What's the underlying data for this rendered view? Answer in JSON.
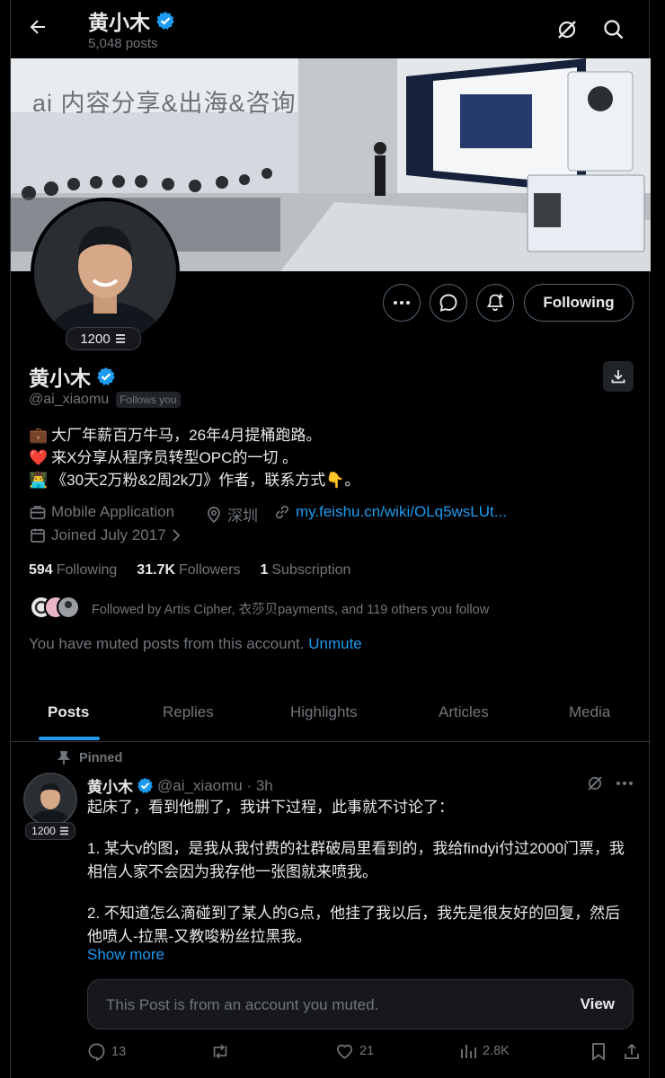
{
  "header": {
    "title": "黄小木",
    "posts_count": "5,048 posts"
  },
  "banner": {
    "overlay_text": "ai 内容分享&出海&咨询"
  },
  "profile": {
    "avatar_badge": "1200",
    "name": "黄小木",
    "handle": "@ai_xiaomu",
    "follows_you": "Follows you",
    "follow_button": "Following",
    "bio": [
      {
        "emoji": "💼",
        "text": "大厂年薪百万牛马，26年4月提桶跑路。"
      },
      {
        "emoji": "❤️",
        "text": "来X分享从程序员转型OPC的一切 。"
      },
      {
        "emoji": "👨‍💻",
        "text": "《30天2万粉&2周2k刀》作者，联系方式👇。"
      }
    ],
    "category": "Mobile Application",
    "location": "深圳",
    "website": "my.feishu.cn/wiki/OLq5wsLUt...",
    "joined": "Joined July 2017",
    "stats": {
      "following_count": "594",
      "following_label": "Following",
      "followers_count": "31.7K",
      "followers_label": "Followers",
      "subscription_count": "1",
      "subscription_label": "Subscription"
    },
    "followed_by": "Followed by Artis Cipher, 衣莎贝payments, and 119 others you follow",
    "muted_note": "You have muted posts from this account.",
    "unmute_label": "Unmute"
  },
  "tabs": [
    "Posts",
    "Replies",
    "Highlights",
    "Articles",
    "Media"
  ],
  "post": {
    "pinned_label": "Pinned",
    "avatar_badge": "1200",
    "author": "黄小木",
    "handle_time": "@ai_xiaomu · 3h",
    "paragraphs": [
      "起床了，看到他删了，我讲下过程，此事就不讨论了：",
      "1. 某大v的图，是我从我付费的社群破局里看到的，我给findyi付过2000门票，我相信人家不会因为我存他一张图就来喷我。",
      "2. 不知道怎么滴碰到了某人的G点，他挂了我以后，我先是很友好的回复，然后他喷人-拉黑-又教唆粉丝拉黑我。"
    ],
    "show_more": "Show more",
    "muted_card_text": "This Post is from an account you muted.",
    "muted_card_action": "View",
    "replies": "13",
    "reposts": "",
    "likes": "21",
    "views": "2.8K"
  },
  "colors": {
    "background": "#000000",
    "accent": "#1d9bf0",
    "muted_text": "#71767b",
    "verified": "#1d9bf0"
  }
}
